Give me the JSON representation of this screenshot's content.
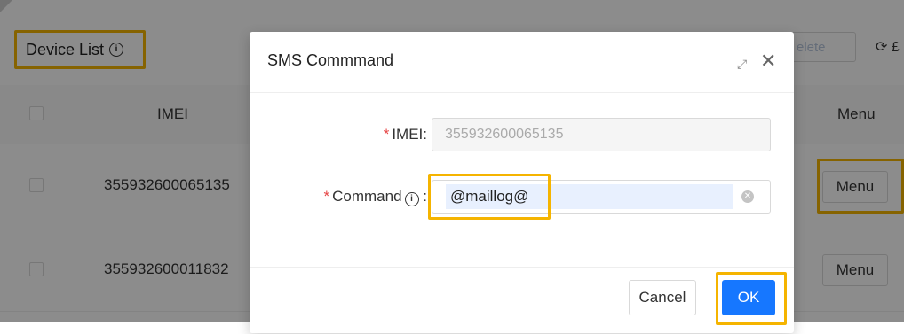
{
  "page": {
    "title": "Device List",
    "title_info_icon": "info-icon"
  },
  "toolbar": {
    "delete_label": "elete",
    "refresh_label": "⟳ £"
  },
  "table": {
    "headers": {
      "imei": "IMEI",
      "menu": "Menu"
    },
    "rows": [
      {
        "imei": "355932600065135",
        "menu_label": "Menu"
      },
      {
        "imei": "355932600011832",
        "menu_label": "Menu"
      }
    ]
  },
  "modal": {
    "title": "SMS Commmand",
    "expand_icon": "expand-icon",
    "close_icon": "close-icon",
    "fields": {
      "imei": {
        "label": "IMEI",
        "value": "355932600065135",
        "required": "*"
      },
      "command": {
        "label": "Command",
        "value": "@maillog@",
        "required": "*",
        "info_icon": "info-icon"
      }
    },
    "footer": {
      "cancel_label": "Cancel",
      "ok_label": "OK"
    }
  },
  "colors": {
    "highlight": "#f5b400",
    "primary": "#1677ff",
    "required": "#e64444",
    "overlay": "rgba(0,0,0,0.45)"
  }
}
